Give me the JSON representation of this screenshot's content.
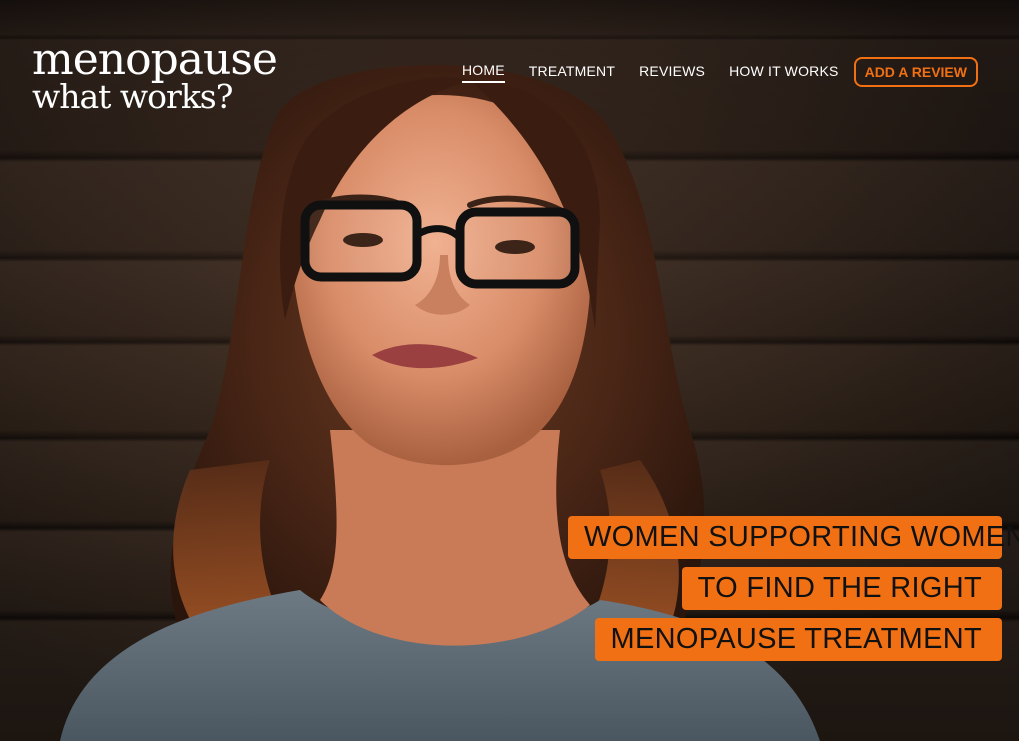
{
  "brand": {
    "line1": "menopause",
    "line2": "what works?"
  },
  "nav": {
    "items": [
      {
        "label": "HOME",
        "active": true
      },
      {
        "label": "TREATMENT",
        "active": false
      },
      {
        "label": "REVIEWS",
        "active": false
      },
      {
        "label": "HOW IT WORKS",
        "active": false
      }
    ],
    "cta": "ADD A REVIEW"
  },
  "hero": {
    "tagline": [
      "WOMEN SUPPORTING WOMEN",
      "TO FIND THE RIGHT",
      "MENOPAUSE TREATMENT"
    ]
  },
  "colors": {
    "accent": "#f07013",
    "text_light": "#ffffff",
    "text_dark": "#111111"
  }
}
